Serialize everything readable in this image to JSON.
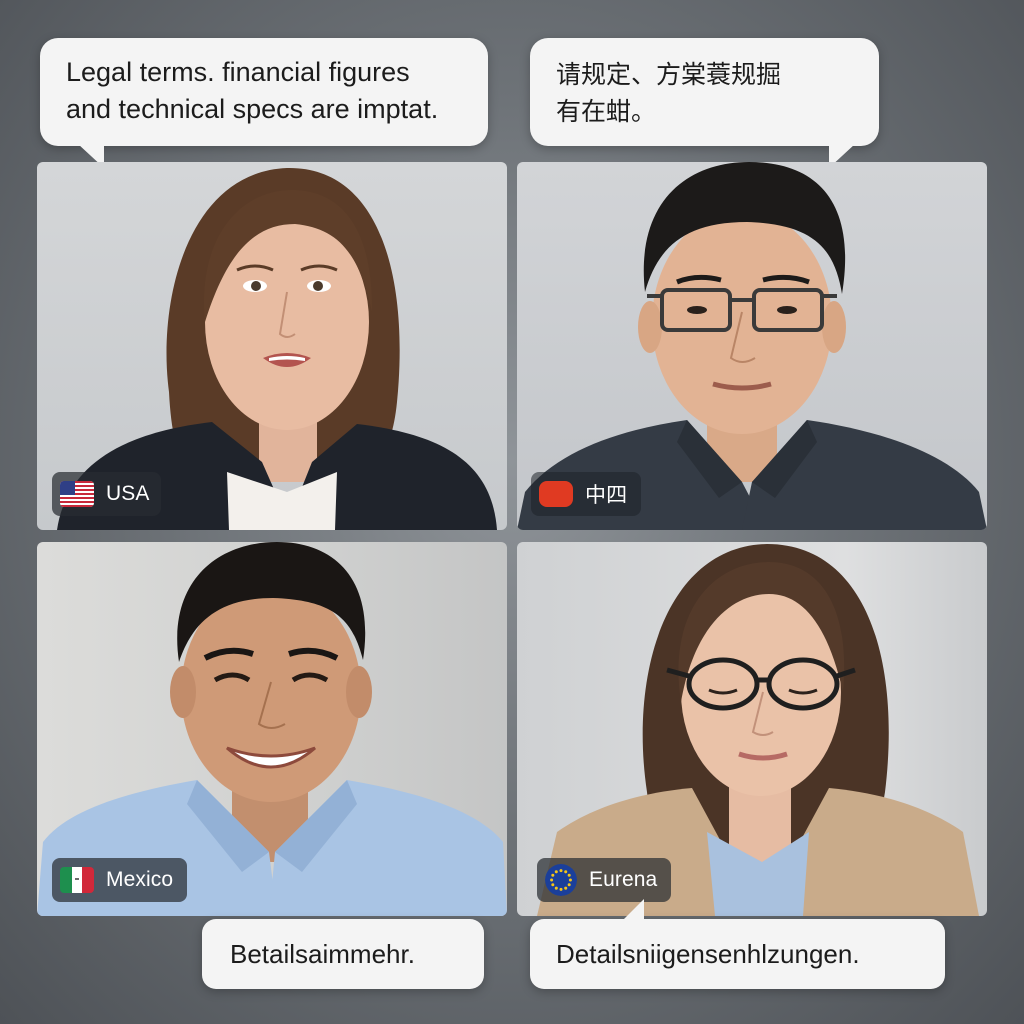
{
  "bubbles": {
    "usa": "Legal terms. financial figures\nand technical specs are imptat.",
    "china": "请规定、方棠蓑规掘\n有在蚶。",
    "mexico": "Betailsaimmehr.",
    "europe": "Detailsniigensenhlzungen."
  },
  "participants": [
    {
      "label": "USA",
      "flag": "us-flag-icon"
    },
    {
      "label": "中四",
      "flag": "china-flag-icon"
    },
    {
      "label": "Mexico",
      "flag": "mexico-flag-icon"
    },
    {
      "label": "Eurena",
      "flag": "eu-flag-icon"
    }
  ],
  "colors": {
    "background": "#6e7378",
    "bubble": "#f4f4f4",
    "badge": "#282c32",
    "china_flag": "#e03a22",
    "eu_blue": "#1b3f9a",
    "eu_star": "#f5c518"
  }
}
